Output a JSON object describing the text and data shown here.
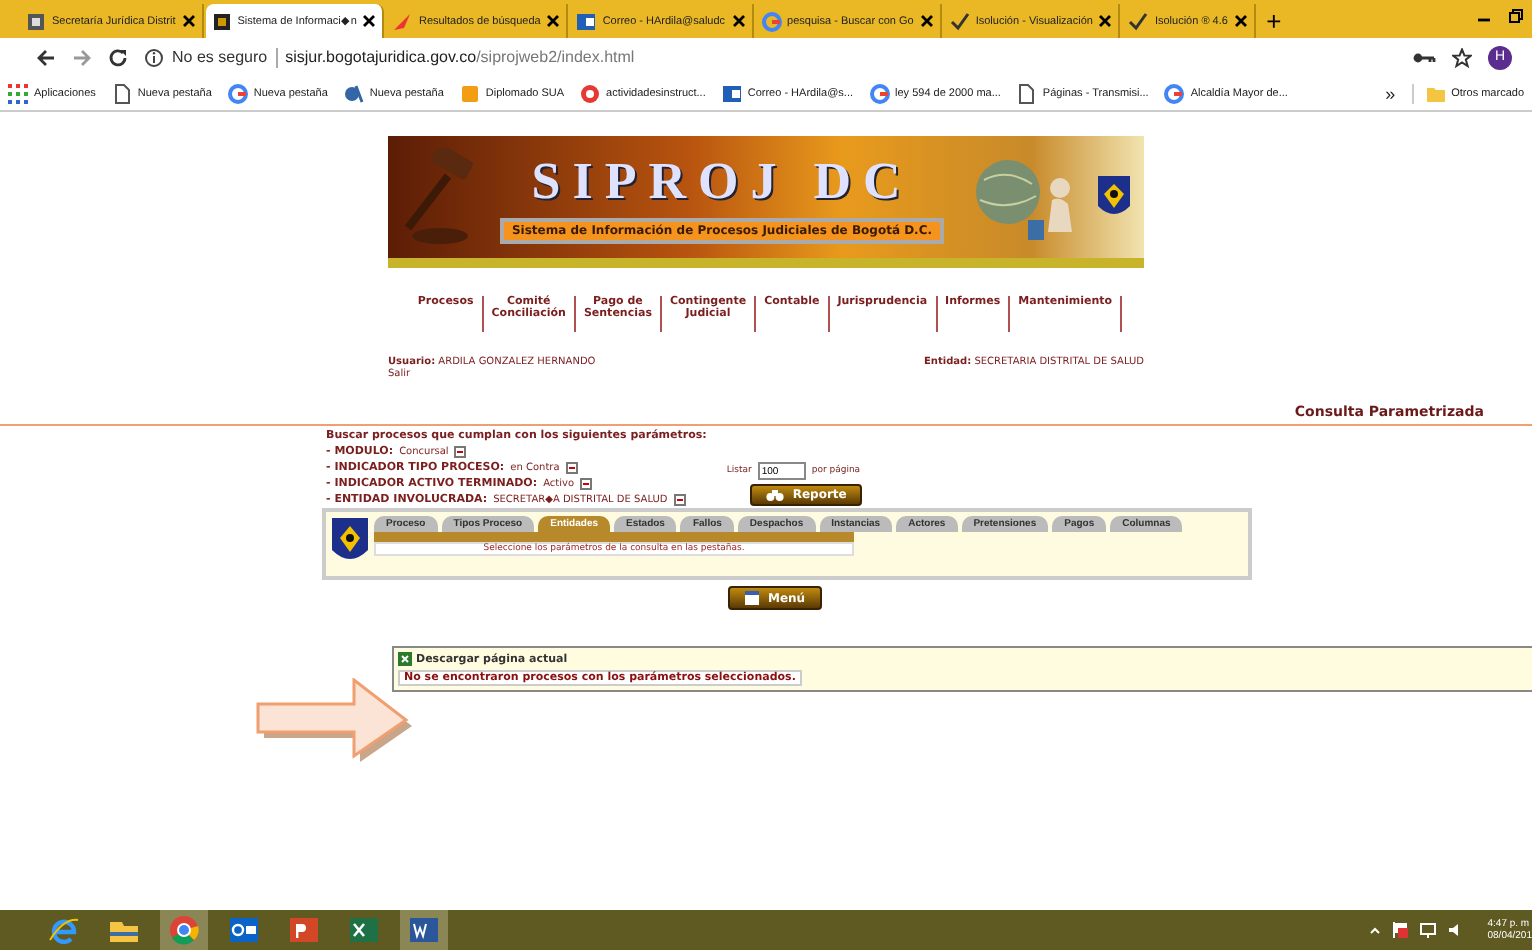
{
  "browser_tabs": [
    {
      "title": "Secretaría Jurídica Distrit",
      "selected": false,
      "kind": "doc"
    },
    {
      "title": "Sistema de Informaci◆n",
      "selected": true,
      "kind": "dark"
    },
    {
      "title": "Resultados de búsqueda",
      "selected": false,
      "kind": "arrow"
    },
    {
      "title": "Correo - HArdila@saludc",
      "selected": false,
      "kind": "mail"
    },
    {
      "title": "pesquisa - Buscar con Go",
      "selected": false,
      "kind": "g"
    },
    {
      "title": "Isolución - Visualización",
      "selected": false,
      "kind": "check"
    },
    {
      "title": "Isolución ® 4.6",
      "selected": false,
      "kind": "check"
    }
  ],
  "new_tab": "+",
  "address_bar": {
    "security": "No es seguro",
    "host": "sisjur.bogotajuridica.gov.co",
    "path": "/siprojweb2/index.html",
    "profile": "H"
  },
  "bookmarks": [
    {
      "label": "Aplicaciones",
      "kind": "apps"
    },
    {
      "label": "Nueva pestaña",
      "kind": "page"
    },
    {
      "label": "Nueva pestaña",
      "kind": "g"
    },
    {
      "label": "Nueva pestaña",
      "kind": "d"
    },
    {
      "label": "Diplomado SUA",
      "kind": "orange"
    },
    {
      "label": "actividadesinstruct...",
      "kind": "red"
    },
    {
      "label": "Correo - HArdila@s...",
      "kind": "mail"
    },
    {
      "label": "ley 594 de 2000 ma...",
      "kind": "g"
    },
    {
      "label": "Páginas - Transmisi...",
      "kind": "page"
    },
    {
      "label": "Alcaldía Mayor de...",
      "kind": "g"
    }
  ],
  "bookmarks_more": "»",
  "other_bookmarks": "Otros marcado",
  "banner": {
    "title": "SIPROJ DC",
    "subtitle": "Sistema de Información de Procesos Judiciales de Bogotá D.C."
  },
  "main_menu": [
    "Procesos",
    "Comité\nConciliación",
    "Pago de\nSentencias",
    "Contingente\nJudicial",
    "Contable",
    "Jurisprudencia",
    "Informes",
    "Mantenimiento"
  ],
  "user": {
    "label": "Usuario:",
    "name": "ARDILA GONZALEZ HERNANDO",
    "logout": "Salir"
  },
  "entity": {
    "label": "Entidad:",
    "name": "SECRETARIA DISTRITAL DE SALUD"
  },
  "page_title": "Consulta Parametrizada",
  "intro": "Buscar procesos que cumplan con los siguientes parámetros:",
  "parameters": [
    {
      "label": "- MODULO:",
      "value": "Concursal"
    },
    {
      "label": "- INDICADOR TIPO PROCESO:",
      "value": "en Contra"
    },
    {
      "label": "- INDICADOR ACTIVO TERMINADO:",
      "value": "Activo"
    },
    {
      "label": "- ENTIDAD INVOLUCRADA:",
      "value": "SECRETAR◆A DISTRITAL DE SALUD"
    }
  ],
  "paging": {
    "before": "Listar",
    "value": "100",
    "after": "por página"
  },
  "report_button": "Reporte",
  "query_tabs": [
    {
      "label": "Proceso",
      "selected": false
    },
    {
      "label": "Tipos Proceso",
      "selected": false
    },
    {
      "label": "Entidades",
      "selected": true
    },
    {
      "label": "Estados",
      "selected": false
    },
    {
      "label": "Fallos",
      "selected": false
    },
    {
      "label": "Despachos",
      "selected": false
    },
    {
      "label": "Instancias",
      "selected": false
    },
    {
      "label": "Actores",
      "selected": false
    },
    {
      "label": "Pretensiones",
      "selected": false
    },
    {
      "label": "Pagos",
      "selected": false
    },
    {
      "label": "Columnas",
      "selected": false
    }
  ],
  "tab_message": "Seleccione los parámetros de la consulta en las pestañas.",
  "menu_button": "Menú",
  "results": {
    "download": "Descargar página actual",
    "message": "No se encontraron procesos con los parámetros seleccionados."
  },
  "taskbar": {
    "apps": [
      {
        "kind": "ie",
        "selected": false
      },
      {
        "kind": "folder",
        "selected": false
      },
      {
        "kind": "chrome",
        "selected": true
      },
      {
        "kind": "outlook",
        "selected": false
      },
      {
        "kind": "powerpoint",
        "selected": false
      },
      {
        "kind": "excel",
        "selected": false
      },
      {
        "kind": "word",
        "selected": true
      }
    ],
    "time": "4:47 p. m",
    "date": "08/04/201"
  }
}
